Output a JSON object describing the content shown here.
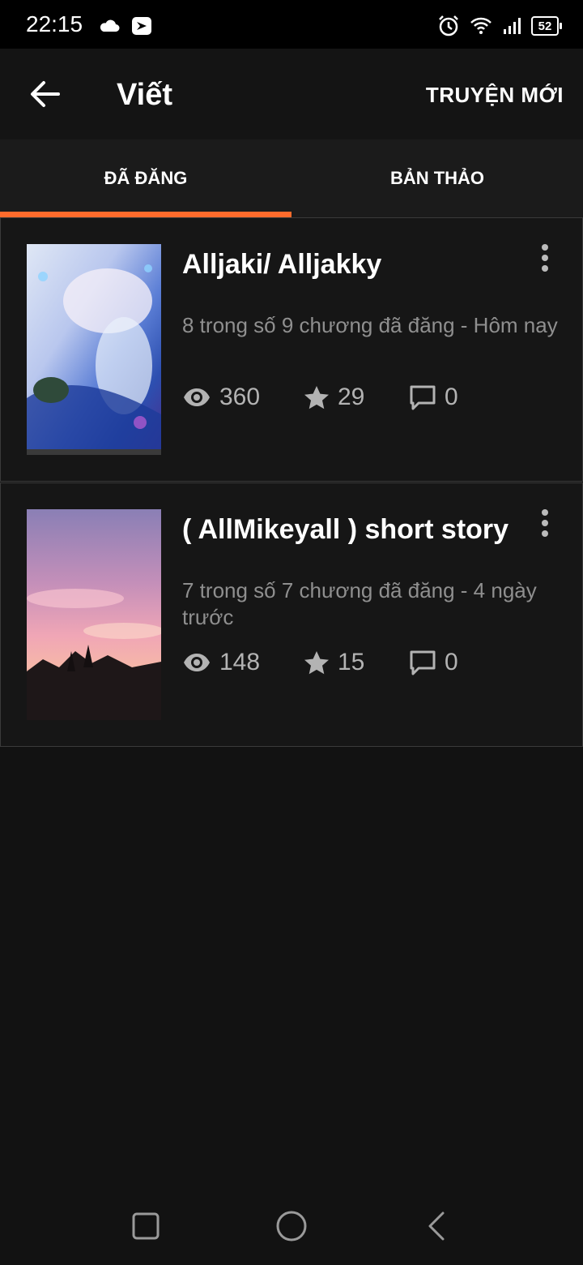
{
  "status_bar": {
    "time": "22:15",
    "battery": "52"
  },
  "app_bar": {
    "title": "Viết",
    "new_story": "TRUYỆN MỚI"
  },
  "tabs": [
    {
      "label": "ĐÃ ĐĂNG",
      "active": true
    },
    {
      "label": "BẢN THẢO",
      "active": false
    }
  ],
  "accent_color": "#ff6b2c",
  "stories": [
    {
      "title": "Alljaki/ Alljakky",
      "meta": "8 trong số 9 chương đã đăng - Hôm nay",
      "views": "360",
      "votes": "29",
      "comments": "0"
    },
    {
      "title": "( AllMikeyall ) short story",
      "meta": "7 trong số 7 chương đã đăng - 4 ngày trước",
      "views": "148",
      "votes": "15",
      "comments": "0"
    }
  ]
}
